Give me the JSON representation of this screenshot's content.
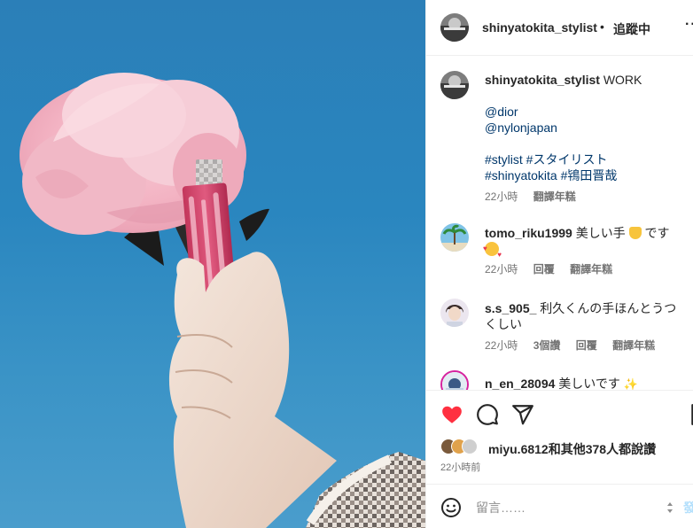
{
  "post": {
    "author": "shinyatokita_stylist",
    "follow_dot": "•",
    "follow_label": "追蹤中",
    "more_label": "···"
  },
  "caption": {
    "username": "shinyatokita_stylist",
    "text": "WORK",
    "mentions": [
      "@dior",
      "@nylonjapan"
    ],
    "hashtag_line1": "#stylist #スタイリスト",
    "hashtag_line2": "#shinyatokita #鴇田晋哉",
    "time": "22小時",
    "translate": "翻譯年糕"
  },
  "comments": [
    {
      "username": "tomo_riku1999",
      "text": "美しい手",
      "emoji_after": "です",
      "time": "22小時",
      "reply": "回覆",
      "translate": "翻譯年糕"
    },
    {
      "username": "s.s_905_",
      "text": "利久くんの手ほんとうつくしい",
      "time": "22小時",
      "likes": "3個讚",
      "reply": "回覆",
      "translate": "翻譯年糕"
    },
    {
      "username": "n_en_28094",
      "text": "美しいです"
    }
  ],
  "likes": {
    "text": "miyu.6812和其他378人都說讚"
  },
  "post_time": "22小時前",
  "comment_box": {
    "placeholder": "留言……",
    "post_label": "發"
  },
  "colors": {
    "like_red": "#ff3040",
    "link_blue": "#00376b",
    "muted": "#737373"
  },
  "icons": [
    "heart-icon",
    "comment-icon",
    "share-icon",
    "bookmark-icon",
    "emoji-icon",
    "more-icon"
  ]
}
